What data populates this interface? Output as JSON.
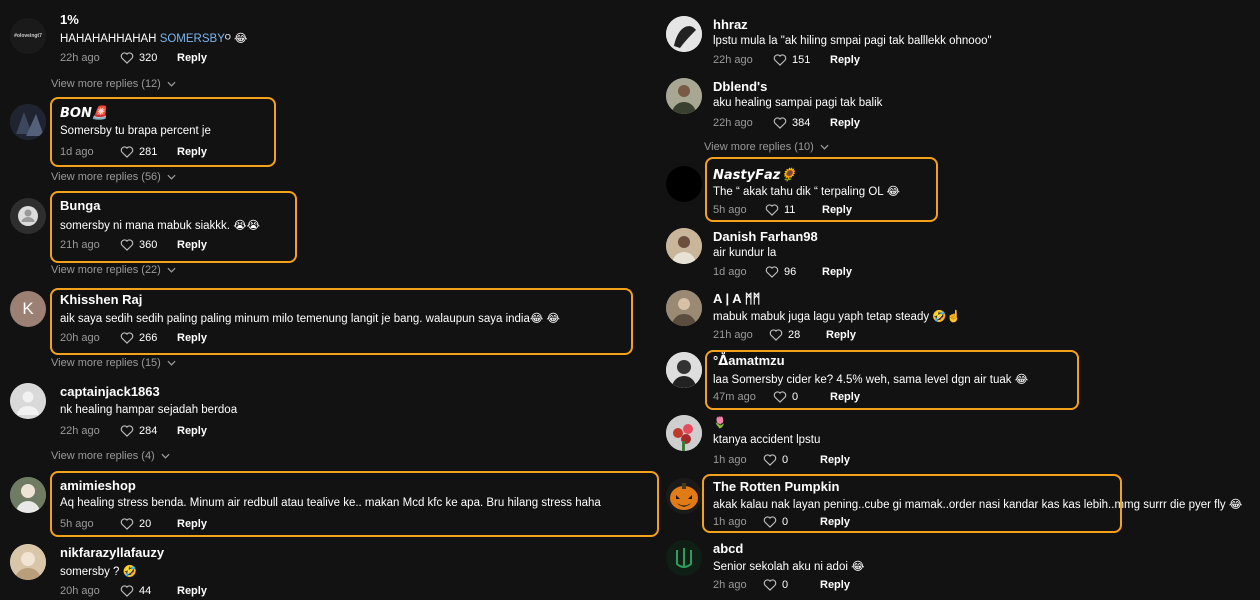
{
  "left": [
    {
      "user": "1%",
      "text": "HAHAHAHHAHAH ",
      "mention": "SOMERSBY",
      "suffix": "ᴼ 😂",
      "time": "22h ago",
      "likes": "320",
      "reply": "Reply",
      "view_more": "View more replies (12)"
    },
    {
      "user": "𝘽𝙊𝙉🚨",
      "text": "Somersby tu brapa percent je",
      "time": "1d ago",
      "likes": "281",
      "reply": "Reply",
      "view_more": "View more replies (56)"
    },
    {
      "user": "Bunga",
      "text": "somersby ni mana mabuk siakkk. 😭😭",
      "time": "21h ago",
      "likes": "360",
      "reply": "Reply",
      "view_more": "View more replies (22)"
    },
    {
      "user": "Khisshen Raj",
      "text": "aik saya sedih sedih paling paling minum milo temenung langit je bang. walaupun saya india😂 😂",
      "time": "20h ago",
      "likes": "266",
      "reply": "Reply",
      "view_more": "View more replies (15)"
    },
    {
      "user": "captainjack1863",
      "text": "nk healing hampar sejadah berdoa",
      "time": "22h ago",
      "likes": "284",
      "reply": "Reply",
      "view_more": "View more replies (4)"
    },
    {
      "user": "amimieshop",
      "text": "Aq healing stress benda. Minum air redbull atau tealive ke.. makan Mcd kfc ke apa. Bru hilang stress haha",
      "time": "5h ago",
      "likes": "20",
      "reply": "Reply"
    },
    {
      "user": "nikfarazyllafauzy",
      "text": "somersby ? 🤣",
      "time": "20h ago",
      "likes": "44",
      "reply": "Reply"
    }
  ],
  "right": [
    {
      "user": "hhraz",
      "text": "lpstu mula la \"ak hiling smpai pagi tak balllekk ohnooo\"",
      "time": "22h ago",
      "likes": "151",
      "reply": "Reply"
    },
    {
      "user": "Dblend's",
      "text": "aku healing sampai pagi tak balik",
      "time": "22h ago",
      "likes": "384",
      "reply": "Reply",
      "view_more": "View more replies (10)"
    },
    {
      "user": "𝙉𝙖𝙨𝙩𝙮𝙁𝙖𝙯🌻",
      "text": "The “ akak tahu dik “ terpaling OL 😂",
      "time": "5h ago",
      "likes": "11",
      "reply": "Reply"
    },
    {
      "user": "Danish Farhan98",
      "text": "air kundur la",
      "time": "1d ago",
      "likes": "96",
      "reply": "Reply"
    },
    {
      "user": "A | A ᛗᛗ",
      "text": "mabuk mabuk juga lagu yaph tetap steady 🤣☝️",
      "time": "21h ago",
      "likes": "28",
      "reply": "Reply"
    },
    {
      "user": "°ᐂamatmzu",
      "text": "laa Somersby cider ke? 4.5% weh, sama level dgn air tuak 😂",
      "time": "47m ago",
      "likes": "0",
      "reply": "Reply"
    },
    {
      "user": "🌷",
      "text": "ktanya accident lpstu",
      "time": "1h ago",
      "likes": "0",
      "reply": "Reply"
    },
    {
      "user": "The Rotten Pumpkin",
      "text": "akak kalau nak layan pening..cube gi mamak..order nasi kandar kas kas lebih..mmg surrr die pyer fly 😂",
      "time": "1h ago",
      "likes": "0",
      "reply": "Reply"
    },
    {
      "user": "abcd",
      "text": "Senior sekolah aku ni adoi 😂",
      "time": "2h ago",
      "likes": "0",
      "reply": "Reply"
    }
  ],
  "avatar_labels": {
    "c0": "#oloveingt7",
    "k": "K"
  },
  "colors": {
    "highlight": "#f5a21b",
    "background": "#121212",
    "mention": "#7ab6f0",
    "muted": "#9a9a9a"
  }
}
